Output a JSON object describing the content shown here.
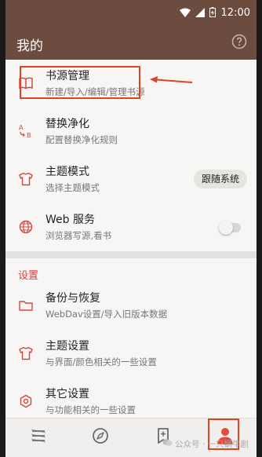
{
  "status_bar": {
    "time": "12:00"
  },
  "app_bar": {
    "title": "我的"
  },
  "menu": [
    {
      "title": "书源管理",
      "subtitle": "新建/导入/编辑/管理书源"
    },
    {
      "title": "替换净化",
      "subtitle": "配置替换净化规则"
    },
    {
      "title": "主题模式",
      "subtitle": "选择主题模式",
      "chip": "跟随系统"
    },
    {
      "title": "Web 服务",
      "subtitle": "浏览器写源,看书"
    }
  ],
  "settings": {
    "header": "设置",
    "items": [
      {
        "title": "备份与恢复",
        "subtitle": "WebDav设置/导入旧版本数据"
      },
      {
        "title": "主题设置",
        "subtitle": "与界面/颜色相关的一些设置"
      },
      {
        "title": "其它设置",
        "subtitle": "与功能相关的一些设置"
      }
    ]
  },
  "bottom_nav": [
    {
      "icon": "bookshelf-icon"
    },
    {
      "icon": "compass-icon"
    },
    {
      "icon": "rss-icon"
    },
    {
      "icon": "profile-icon"
    }
  ],
  "watermark": "公众号 · 一只蜗牛剧"
}
